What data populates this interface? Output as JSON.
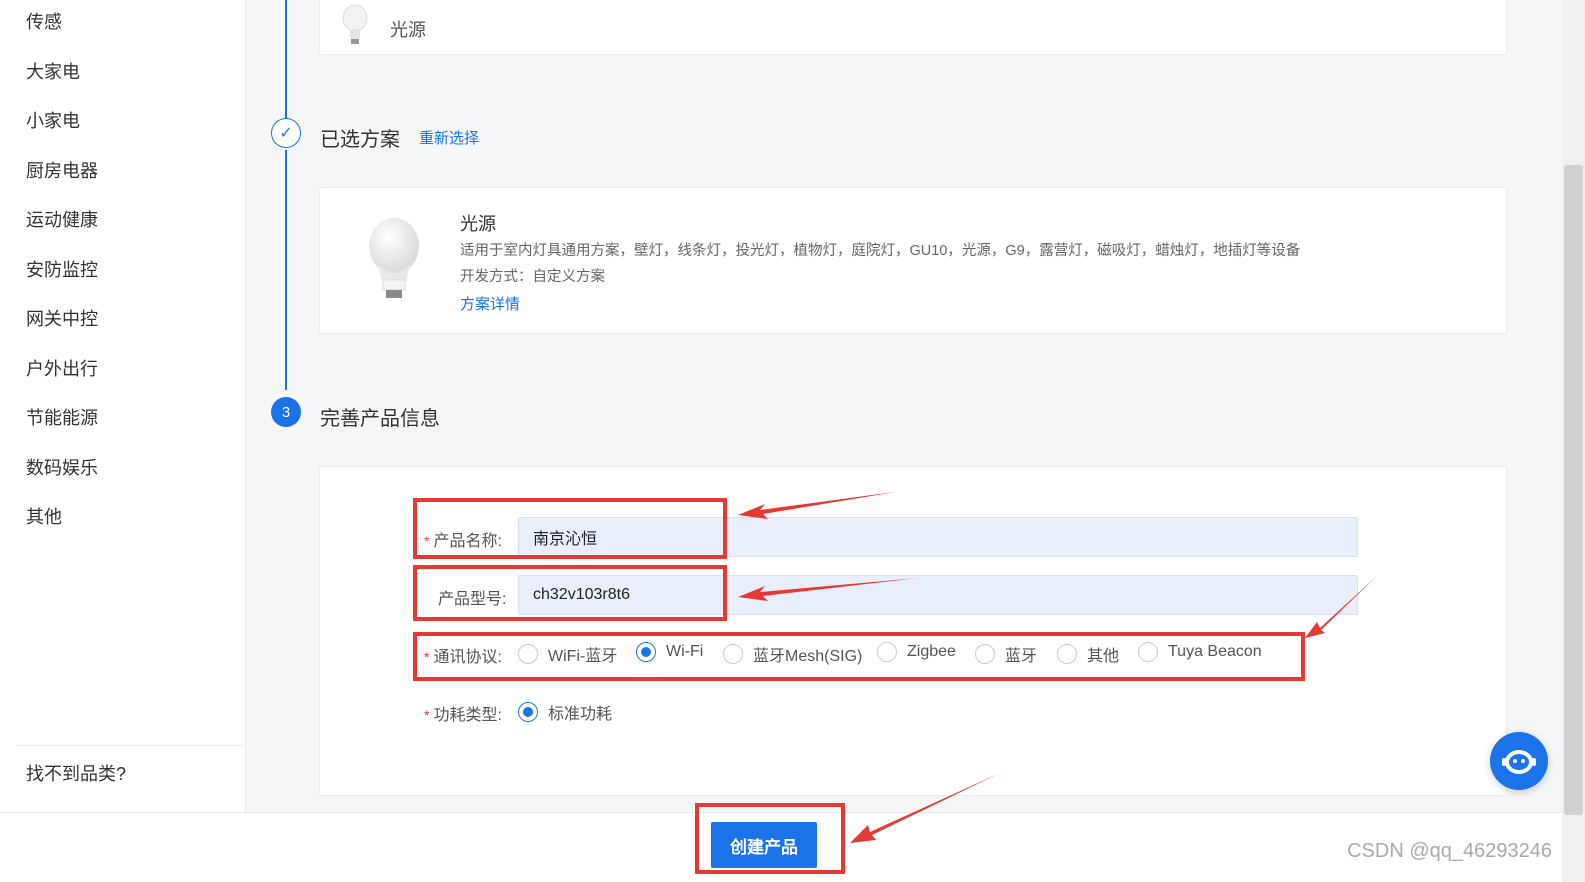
{
  "sidebar": {
    "categories": [
      "传感",
      "大家电",
      "小家电",
      "厨房电器",
      "运动健康",
      "安防监控",
      "网关中控",
      "户外出行",
      "节能能源",
      "数码娱乐",
      "其他"
    ],
    "not_found": "找不到品类?"
  },
  "top_card": {
    "name": "光源"
  },
  "step2": {
    "title": "已选方案",
    "reselect": "重新选择"
  },
  "solution": {
    "name": "光源",
    "desc": "适用于室内灯具通用方案，壁灯，线条灯，投光灯，植物灯，庭院灯，GU10，光源，G9，露营灯，磁吸灯，蜡烛灯，地插灯等设备",
    "dev_mode": "开发方式：自定义方案",
    "detail_link": "方案详情"
  },
  "step3": {
    "number": "3",
    "title": "完善产品信息"
  },
  "form": {
    "required_mark": "*",
    "name_label": "产品名称:",
    "name_value": "南京沁恒",
    "model_label": "产品型号:",
    "model_value": "ch32v103r8t6",
    "protocol_label": "通讯协议:",
    "protocols": [
      "WiFi-蓝牙",
      "Wi-Fi",
      "蓝牙Mesh(SIG)",
      "Zigbee",
      "蓝牙",
      "其他",
      "Tuya Beacon"
    ],
    "protocol_selected": "Wi-Fi",
    "power_label": "功耗类型:",
    "power_option": "标准功耗"
  },
  "footer": {
    "create_button": "创建产品"
  },
  "watermark": "CSDN @qq_46293246",
  "colors": {
    "primary": "#1a73e8",
    "annotation": "#e53935"
  }
}
